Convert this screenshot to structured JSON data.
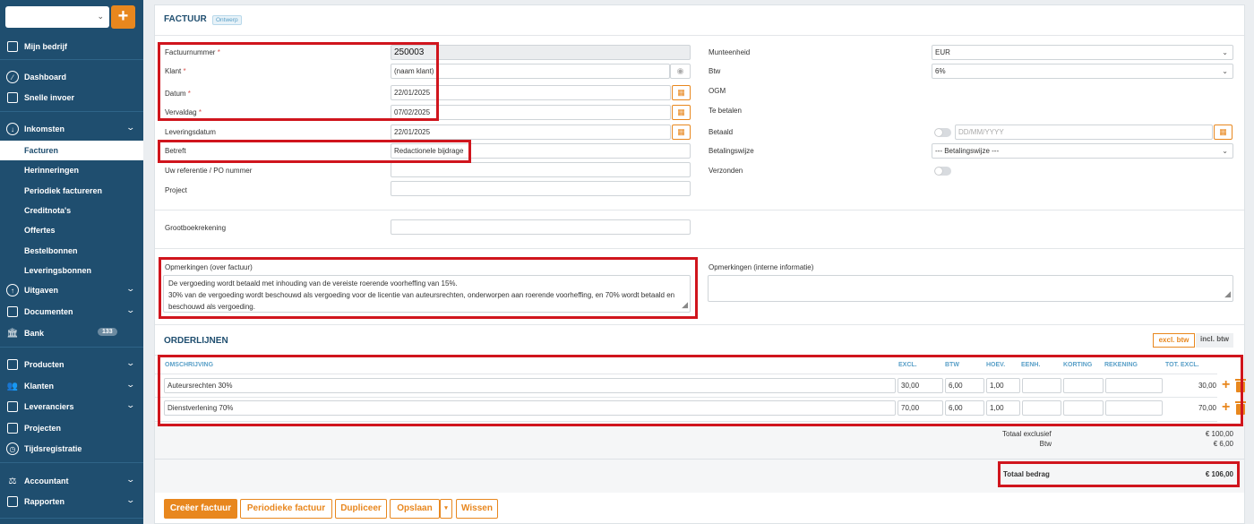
{
  "sidebar": {
    "items": [
      {
        "label": "Mijn bedrijf"
      },
      {
        "label": "Dashboard"
      },
      {
        "label": "Snelle invoer"
      },
      {
        "label": "Inkomsten"
      },
      {
        "label": "Facturen"
      },
      {
        "label": "Herinneringen"
      },
      {
        "label": "Periodiek factureren"
      },
      {
        "label": "Creditnota's"
      },
      {
        "label": "Offertes"
      },
      {
        "label": "Bestelbonnen"
      },
      {
        "label": "Leveringsbonnen"
      },
      {
        "label": "Uitgaven"
      },
      {
        "label": "Documenten"
      },
      {
        "label": "Bank",
        "badge": "133"
      },
      {
        "label": "Producten"
      },
      {
        "label": "Klanten"
      },
      {
        "label": "Leveranciers"
      },
      {
        "label": "Projecten"
      },
      {
        "label": "Tijdsregistratie"
      },
      {
        "label": "Accountant"
      },
      {
        "label": "Rapporten"
      }
    ],
    "add_label": "+"
  },
  "header": {
    "title": "FACTUUR",
    "status": "Ontwerp"
  },
  "form": {
    "factuurnummer_label": "Factuurnummer",
    "factuurnummer": "250003",
    "klant_label": "Klant",
    "klant_placeholder": "(naam klant)",
    "datum_label": "Datum",
    "datum": "22/01/2025",
    "vervaldag_label": "Vervaldag",
    "vervaldag": "07/02/2025",
    "leveringsdatum_label": "Leveringsdatum",
    "leveringsdatum": "22/01/2025",
    "betreft_label": "Betreft",
    "betreft": "Redactionele bijdrage",
    "referentie_label": "Uw referentie / PO nummer",
    "project_label": "Project",
    "grootboek_label": "Grootboekrekening",
    "munteenheid_label": "Munteenheid",
    "munteenheid": "EUR",
    "btw_label": "Btw",
    "btw": "6%",
    "ogm_label": "OGM",
    "te_betalen_label": "Te betalen",
    "betaald_label": "Betaald",
    "betaald_placeholder": "DD/MM/YYYY",
    "betalingswijze_label": "Betalingswijze",
    "betalingswijze": "--- Betalingswijze ---",
    "verzonden_label": "Verzonden",
    "opm_factuur_label": "Opmerkingen (over factuur)",
    "opm_factuur_line1": "De vergoeding wordt betaald met inhouding van de vereiste roerende voorheffing van 15%.",
    "opm_factuur_line2": "30% van de vergoeding wordt beschouwd als vergoeding voor de licentie van auteursrechten, onderworpen aan roerende voorheffing, en 70% wordt betaald en",
    "opm_factuur_line3": "beschouwd als vergoeding.",
    "opm_intern_label": "Opmerkingen (interne informatie)"
  },
  "orderlijnen": {
    "title": "ORDERLIJNEN",
    "excl_btw": "excl. btw",
    "incl_btw": "incl. btw",
    "columns": [
      "OMSCHRIJVING",
      "EXCL.",
      "BTW",
      "HOEV.",
      "EENH.",
      "KORTING",
      "REKENING",
      "TOT. EXCL."
    ],
    "rows": [
      {
        "omschrijving": "Auteursrechten 30%",
        "excl": "30,00",
        "btw": "6,00",
        "hoev": "1,00",
        "eenh": "",
        "korting": "",
        "rekening": "",
        "tot": "30,00"
      },
      {
        "omschrijving": "Dienstverlening 70%",
        "excl": "70,00",
        "btw": "6,00",
        "hoev": "1,00",
        "eenh": "",
        "korting": "",
        "rekening": "",
        "tot": "70,00"
      }
    ]
  },
  "totals": {
    "excl_label": "Totaal exclusief",
    "excl_value": "€ 100,00",
    "btw_label": "Btw",
    "btw_value": "€ 6,00",
    "totaal_label": "Totaal bedrag",
    "totaal_value": "€ 106,00"
  },
  "actions": {
    "creeer": "Creëer factuur",
    "periodiek": "Periodieke factuur",
    "dupliceer": "Dupliceer",
    "opslaan": "Opslaan",
    "wissen": "Wissen"
  },
  "colors": {
    "sidebar": "#1f4e6f",
    "accent": "#e8871e",
    "highlight": "#d0151d"
  }
}
